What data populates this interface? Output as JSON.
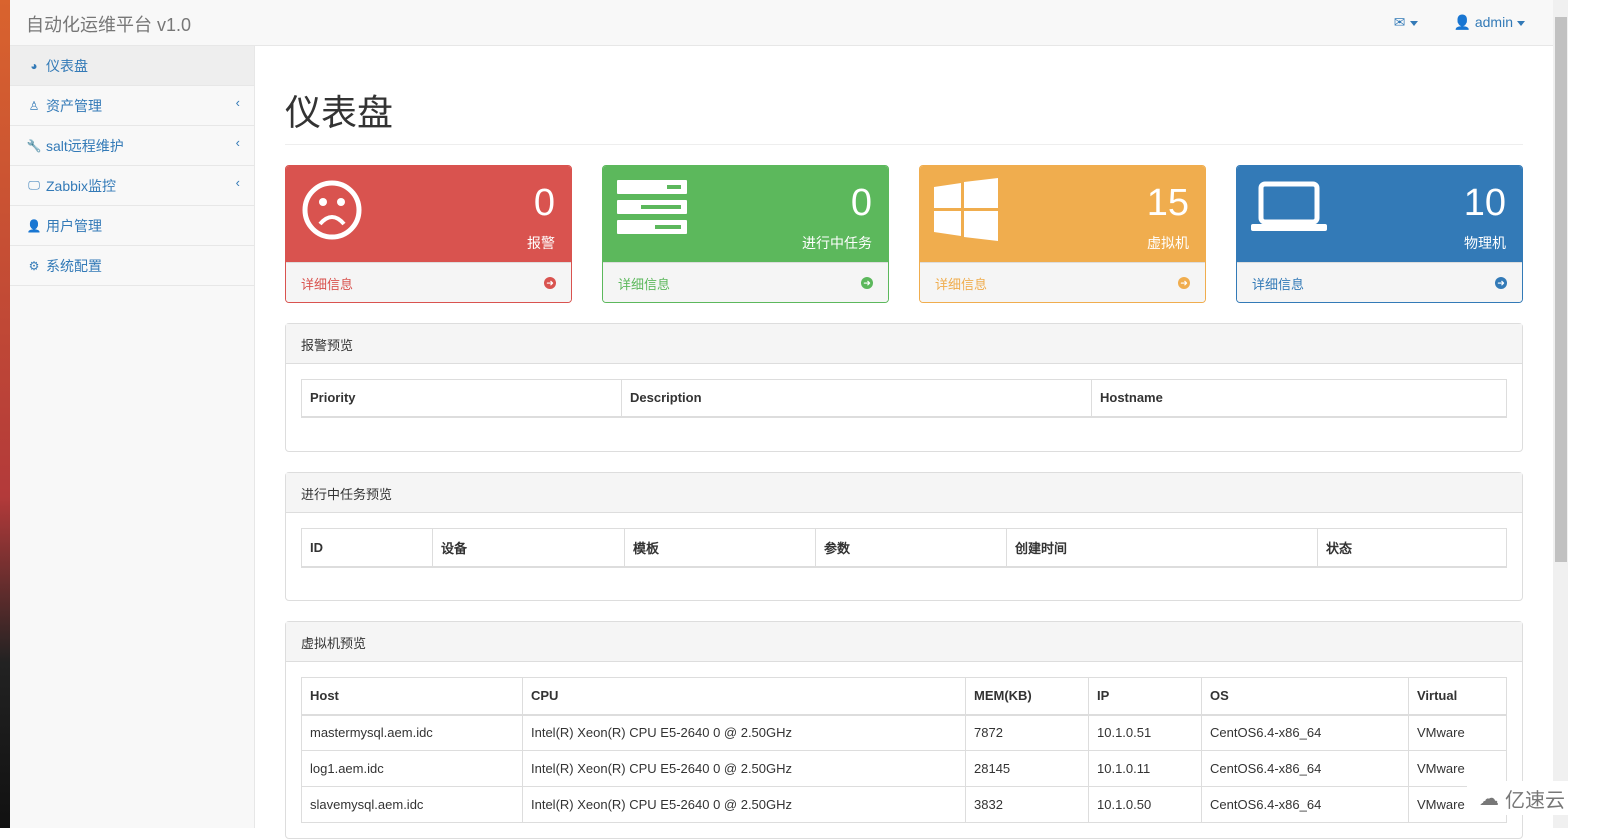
{
  "navbar": {
    "brand": "自动化运维平台 v1.0",
    "user": "admin"
  },
  "sidebar": {
    "items": [
      {
        "label": "仪表盘",
        "icon": "dashboard-icon",
        "active": true
      },
      {
        "label": "资产管理",
        "icon": "linux-icon",
        "expandable": true
      },
      {
        "label": "salt远程维护",
        "icon": "wrench-icon",
        "expandable": true
      },
      {
        "label": "Zabbix监控",
        "icon": "desktop-icon",
        "expandable": true
      },
      {
        "label": "用户管理",
        "icon": "user-icon"
      },
      {
        "label": "系统配置",
        "icon": "gear-icon"
      }
    ]
  },
  "page_title": "仪表盘",
  "cards": [
    {
      "value": "0",
      "label": "报警",
      "link": "详细信息",
      "color": "#d9534f",
      "icon": "frown-icon"
    },
    {
      "value": "0",
      "label": "进行中任务",
      "link": "详细信息",
      "color": "#5cb85c",
      "icon": "tasks-icon"
    },
    {
      "value": "15",
      "label": "虚拟机",
      "link": "详细信息",
      "color": "#f0ad4e",
      "icon": "windows-icon"
    },
    {
      "value": "10",
      "label": "物理机",
      "link": "详细信息",
      "color": "#337ab7",
      "icon": "laptop-icon"
    }
  ],
  "alerts": {
    "title": "报警预览",
    "columns": [
      "Priority",
      "Description",
      "Hostname"
    ]
  },
  "tasks": {
    "title": "进行中任务预览",
    "columns": [
      "ID",
      "设备",
      "模板",
      "参数",
      "创建时间",
      "状态"
    ]
  },
  "vms": {
    "title": "虚拟机预览",
    "columns": [
      "Host",
      "CPU",
      "MEM(KB)",
      "IP",
      "OS",
      "Virtual"
    ],
    "rows": [
      [
        "mastermysql.aem.idc",
        "Intel(R) Xeon(R) CPU E5-2640 0 @ 2.50GHz",
        "7872",
        "10.1.0.51",
        "CentOS6.4-x86_64",
        "VMware"
      ],
      [
        "log1.aem.idc",
        "Intel(R) Xeon(R) CPU E5-2640 0 @ 2.50GHz",
        "28145",
        "10.1.0.11",
        "CentOS6.4-x86_64",
        "VMware"
      ],
      [
        "slavemysql.aem.idc",
        "Intel(R) Xeon(R) CPU E5-2640 0 @ 2.50GHz",
        "3832",
        "10.1.0.50",
        "CentOS6.4-x86_64",
        "VMware"
      ]
    ]
  },
  "watermark": "亿速云"
}
